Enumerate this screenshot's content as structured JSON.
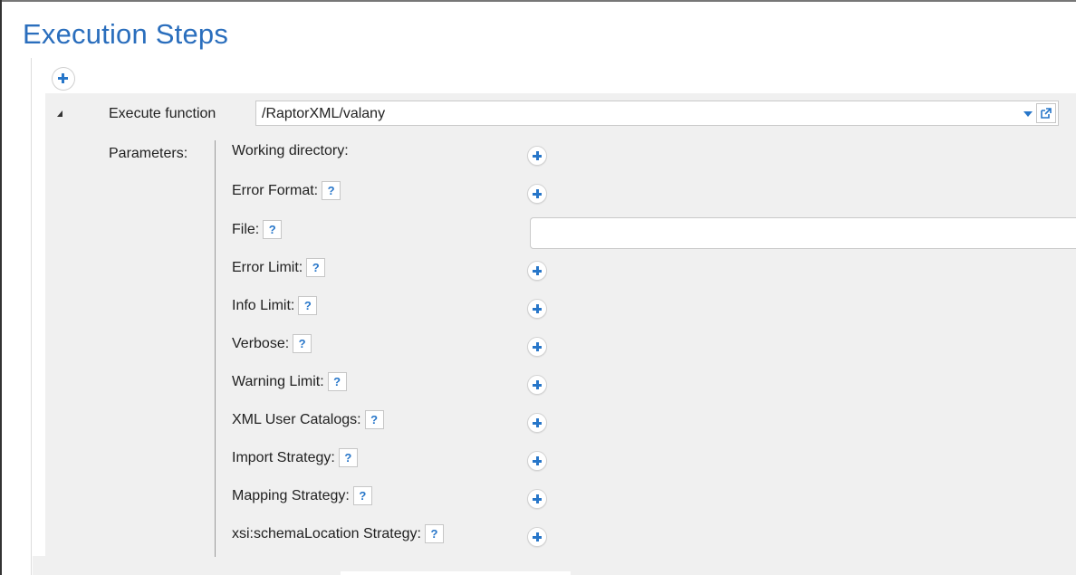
{
  "page": {
    "title": "Execution Steps"
  },
  "step": {
    "label": "Execute function",
    "function_value": "/RaptorXML/valany"
  },
  "parameters": {
    "label": "Parameters:",
    "items": [
      {
        "name": "Working directory:",
        "help": false,
        "control": "add"
      },
      {
        "name": "Error Format:",
        "help": true,
        "control": "add"
      },
      {
        "name": "File:",
        "help": true,
        "control": "input",
        "value": ""
      },
      {
        "name": "Error Limit:",
        "help": true,
        "control": "add"
      },
      {
        "name": "Info Limit:",
        "help": true,
        "control": "add"
      },
      {
        "name": "Verbose:",
        "help": true,
        "control": "add"
      },
      {
        "name": "Warning Limit:",
        "help": true,
        "control": "add"
      },
      {
        "name": "XML User Catalogs:",
        "help": true,
        "control": "add"
      },
      {
        "name": "Import Strategy:",
        "help": true,
        "control": "add"
      },
      {
        "name": "Mapping Strategy:",
        "help": true,
        "control": "add"
      },
      {
        "name": "xsi:schemaLocation Strategy:",
        "help": true,
        "control": "add"
      }
    ]
  },
  "help_glyph": "?",
  "icons": {
    "add_step": "plus-icon",
    "collapse": "triangle-down-icon",
    "dropdown": "caret-down-icon",
    "open_function": "external-link-icon",
    "add_param": "plus-icon"
  },
  "colors": {
    "accent": "#2776c9",
    "title": "#2a6ebd",
    "panel": "#f0f0f0"
  }
}
